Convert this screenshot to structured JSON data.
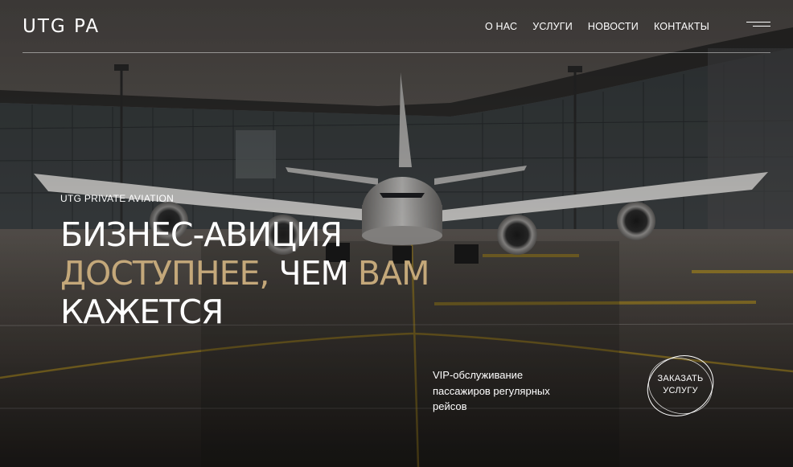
{
  "header": {
    "logo": "UTG PA",
    "nav": [
      "О НАС",
      "УСЛУГИ",
      "НОВОСТИ",
      "КОНТАКТЫ"
    ],
    "menu_icon": "hamburger-icon"
  },
  "hero": {
    "eyebrow": "UTG PRIVATE AVIATION",
    "headline": {
      "line1": "БИЗНЕС-АВИЦИЯ",
      "line2_a": "ДОСТУПНЕЕ,",
      "line2_b": " ЧЕМ ",
      "line2_c": "ВАМ",
      "line3": "КАЖЕТСЯ"
    },
    "description": "VIP-обслуживание пассажиров регулярных рейсов",
    "cta": {
      "line1": "ЗАКАЗАТЬ",
      "line2": "УСЛУГУ"
    }
  },
  "colors": {
    "accent_gold": "#c4a87a",
    "text": "#ffffff",
    "taxiway_yellow": "#b8962a"
  }
}
